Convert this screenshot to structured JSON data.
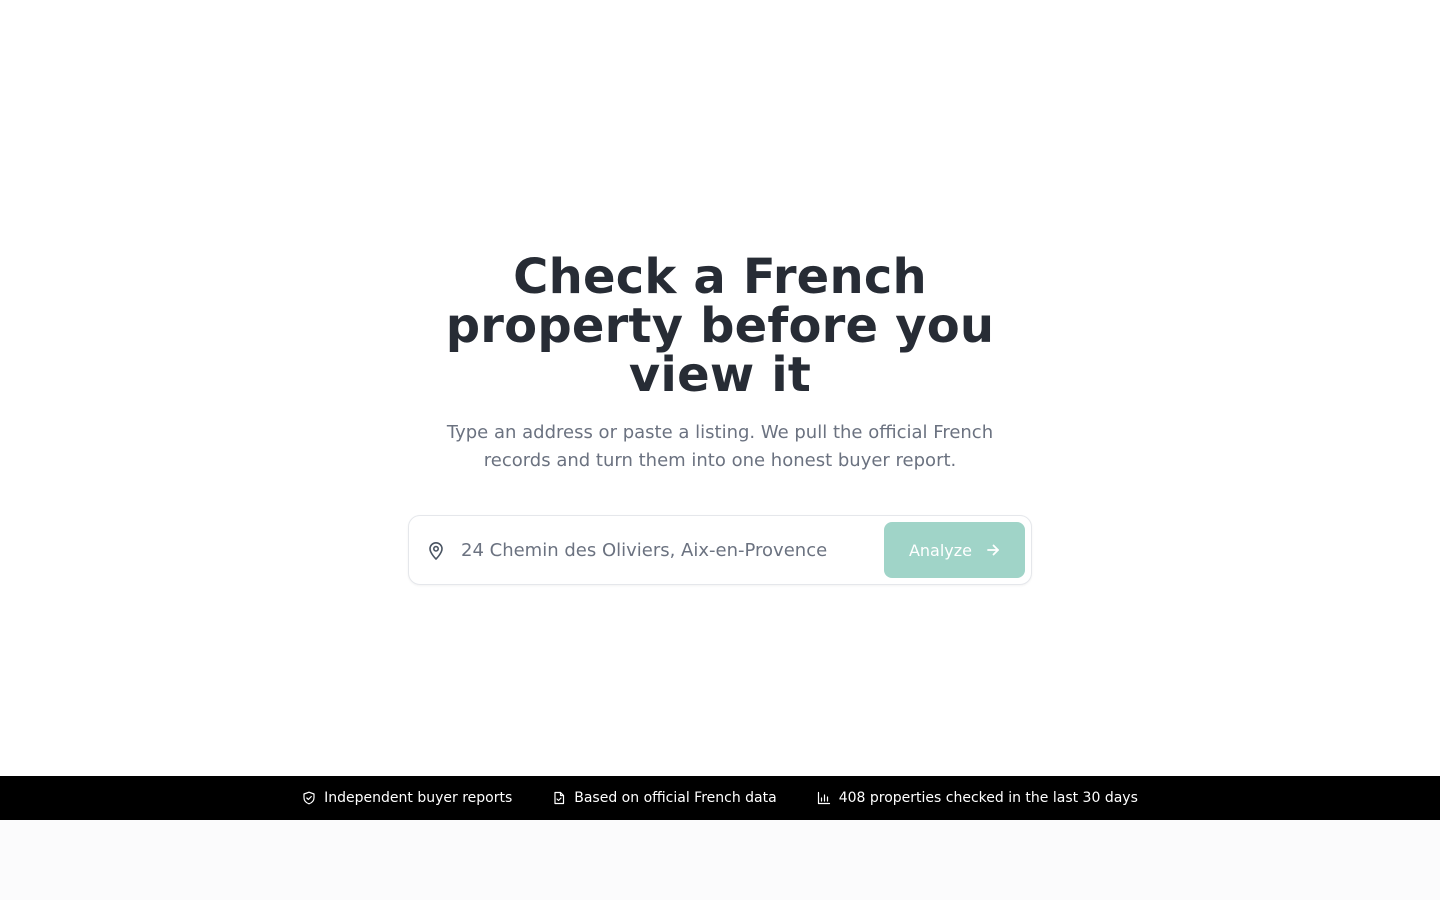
{
  "hero": {
    "headline": "Check a French property before you view it",
    "subhead": "Type an address or paste a listing. We pull the official French records and turn them into one honest buyer report."
  },
  "search": {
    "placeholder": "24 Chemin des Oliviers, Aix-en-Provence",
    "value": "",
    "icon": "map-pin-icon",
    "button_label": "Analyze",
    "button_icon": "arrow-right-icon",
    "button_color": "#a0d4c8"
  },
  "trust_bar": {
    "items": [
      {
        "icon": "shield-check-icon",
        "label": "Independent buyer reports"
      },
      {
        "icon": "document-icon",
        "label": "Based on official French data"
      },
      {
        "icon": "bar-chart-icon",
        "label": "408 properties checked in the last 30 days"
      }
    ]
  },
  "colors": {
    "headline": "#272c35",
    "body_text": "#6b7280",
    "accent": "#a0d4c8",
    "trust_bar_bg": "#000000"
  }
}
